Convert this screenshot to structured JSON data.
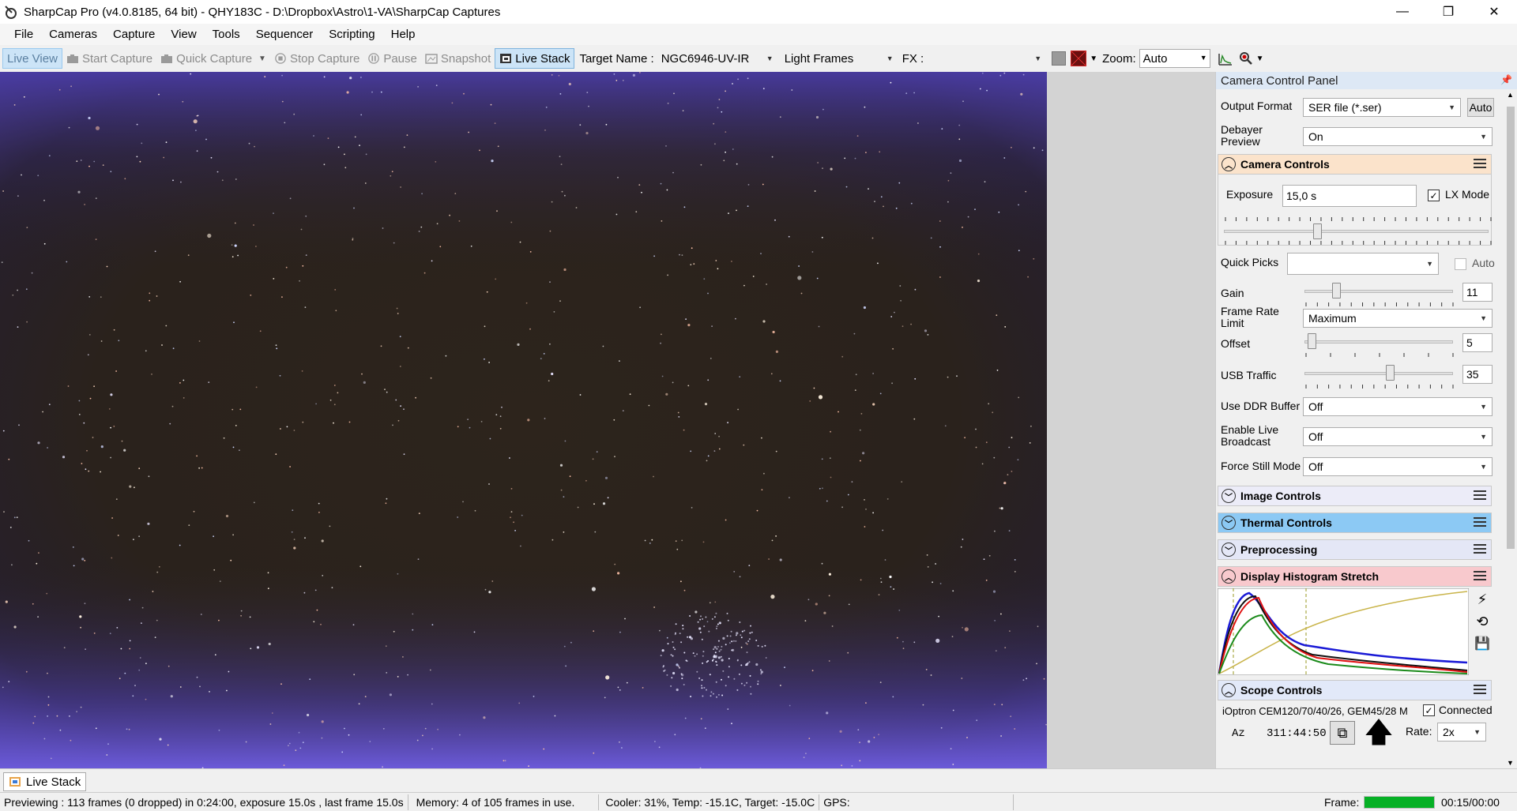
{
  "window": {
    "title": "SharpCap Pro (v4.0.8185, 64 bit) - QHY183C - D:\\Dropbox\\Astro\\1-VA\\SharpCap Captures",
    "minimize": "—",
    "maximize": "❐",
    "close": "✕"
  },
  "menu": [
    "File",
    "Cameras",
    "Capture",
    "View",
    "Tools",
    "Sequencer",
    "Scripting",
    "Help"
  ],
  "toolbar": {
    "live_view": "Live View",
    "start_capture": "Start Capture",
    "quick_capture": "Quick Capture",
    "stop_capture": "Stop Capture",
    "pause": "Pause",
    "snapshot": "Snapshot",
    "live_stack": "Live Stack",
    "target_name_label": "Target Name :",
    "target_name_value": "NGC6946-UV-IR",
    "frame_type": "Light Frames",
    "fx_label": "FX :",
    "fx_value": "",
    "zoom_label": "Zoom:",
    "zoom_value": "Auto"
  },
  "panel": {
    "title": "Camera Control Panel",
    "output_format_label": "Output Format",
    "output_format_value": "SER file (*.ser)",
    "auto_button": "Auto",
    "debayer_label_1": "Debayer",
    "debayer_label_2": "Preview",
    "debayer_value": "On",
    "camera_controls": {
      "title": "Camera Controls",
      "exposure_label": "Exposure",
      "exposure_value": "15,0 s",
      "lx_mode_label": "LX Mode",
      "lx_mode_checked": true,
      "exposure_slider_fraction": 0.35,
      "quick_picks_label": "Quick Picks",
      "quick_picks_value": "",
      "quick_picks_auto_label": "Auto",
      "gain_label": "Gain",
      "gain_value": "11",
      "gain_slider_fraction": 0.2,
      "frame_rate_label_1": "Frame Rate",
      "frame_rate_label_2": "Limit",
      "frame_rate_value": "Maximum",
      "offset_label": "Offset",
      "offset_value": "5",
      "offset_slider_fraction": 0.02,
      "usb_label": "USB Traffic",
      "usb_value": "35",
      "usb_slider_fraction": 0.58,
      "ddr_label": "Use DDR Buffer",
      "ddr_value": "Off",
      "broadcast_label_1": "Enable Live",
      "broadcast_label_2": "Broadcast",
      "broadcast_value": "Off",
      "still_label": "Force Still Mode",
      "still_value": "Off"
    },
    "sections": {
      "image": "Image Controls",
      "thermal": "Thermal Controls",
      "preprocessing": "Preprocessing",
      "histogram": "Display Histogram Stretch",
      "scope": "Scope Controls"
    },
    "scope": {
      "mount": "iOptron CEM120/70/40/26, GEM45/28 M",
      "connected_label": "Connected",
      "connected_checked": true,
      "az_label": "Az",
      "az_value": "311:44:50",
      "rate_label": "Rate:",
      "rate_value": "2x"
    }
  },
  "tabs": {
    "live_stack": "Live Stack"
  },
  "status": {
    "preview": "Previewing : 113 frames (0 dropped) in 0:24:00, exposure 15.0s , last frame 15.0s",
    "memory": "Memory: 4 of 105 frames in use.",
    "cooler": "Cooler: 31%, Temp: -15.1C, Target: -15.0C",
    "gps": "GPS:",
    "frame_label": "Frame:",
    "frame_progress": 1.0,
    "frame_time": "00:15/00:00"
  },
  "colors": {
    "accent": "#cce4f7",
    "thermal_header": "#8cc9f4",
    "camera_header": "#fbe3cb",
    "histogram_header": "#f8c9cd",
    "progress_green": "#06b025"
  }
}
